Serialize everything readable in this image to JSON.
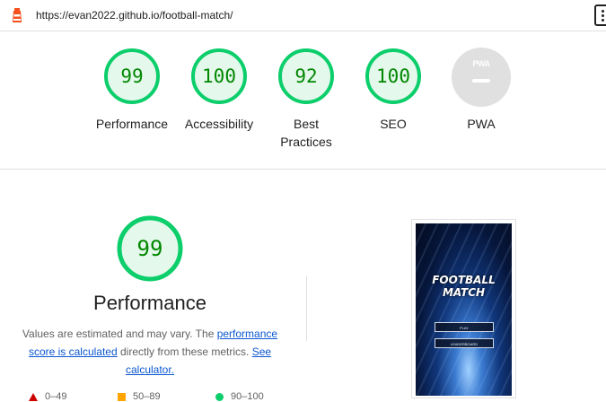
{
  "header": {
    "url": "https://evan2022.github.io/football-match/"
  },
  "colors": {
    "pass": "#0cce6b",
    "pass_text": "#008800",
    "pass_fill": "#e5f8ec",
    "pwa_gray": "#e0e0e0",
    "link": "#0b57d0"
  },
  "scores": [
    {
      "value": "99",
      "label": "Performance"
    },
    {
      "value": "100",
      "label": "Accessibility"
    },
    {
      "value": "92",
      "label": "Best Practices"
    },
    {
      "value": "100",
      "label": "SEO"
    },
    {
      "value": "",
      "label": "PWA",
      "badge_text": "PWA"
    }
  ],
  "performance": {
    "score": "99",
    "title": "Performance",
    "desc_prefix": "Values are estimated and may vary. The ",
    "link1": "performance score is calculated",
    "desc_middle": " directly from these metrics. ",
    "link2": "See calculator.",
    "legend": [
      {
        "icon": "triangle-red-icon",
        "range": "0–49"
      },
      {
        "icon": "square-orange-icon",
        "range": "50–89"
      },
      {
        "icon": "circle-green-icon",
        "range": "90–100"
      }
    ]
  },
  "screenshot": {
    "game_title_line1": "FOOTBALL",
    "game_title_line2": "MATCH",
    "button1": "PLAY",
    "button2": "LEADERBOARD"
  }
}
